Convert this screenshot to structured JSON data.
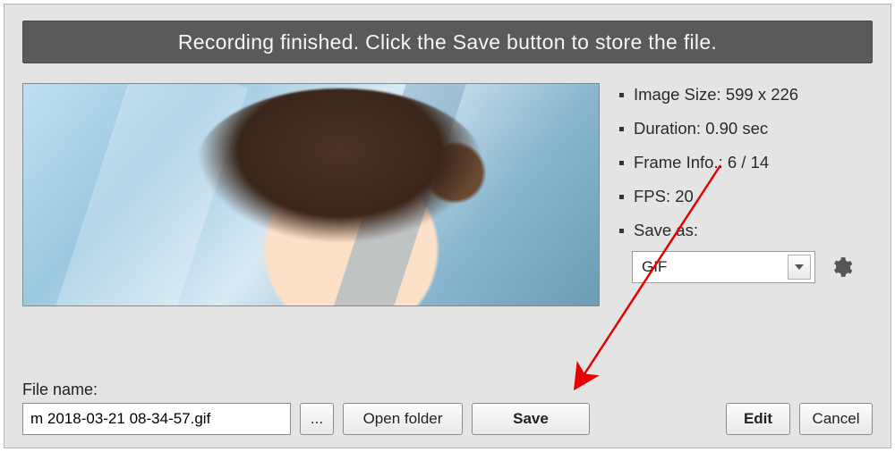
{
  "banner": "Recording finished. Click the Save button to store the file.",
  "info": {
    "image_size_label": "Image Size:",
    "image_size_value": "599 x 226",
    "duration_label": "Duration:",
    "duration_value": "0.90 sec",
    "frame_label": "Frame Info.:",
    "frame_value": "6 / 14",
    "fps_label": "FPS:",
    "fps_value": "20",
    "saveas_label": "Save as:"
  },
  "saveas_format": "GIF",
  "filename_label": "File name:",
  "filename_value": "m 2018-03-21 08-34-57.gif",
  "buttons": {
    "browse": "...",
    "open_folder": "Open folder",
    "save": "Save",
    "edit": "Edit",
    "cancel": "Cancel"
  }
}
